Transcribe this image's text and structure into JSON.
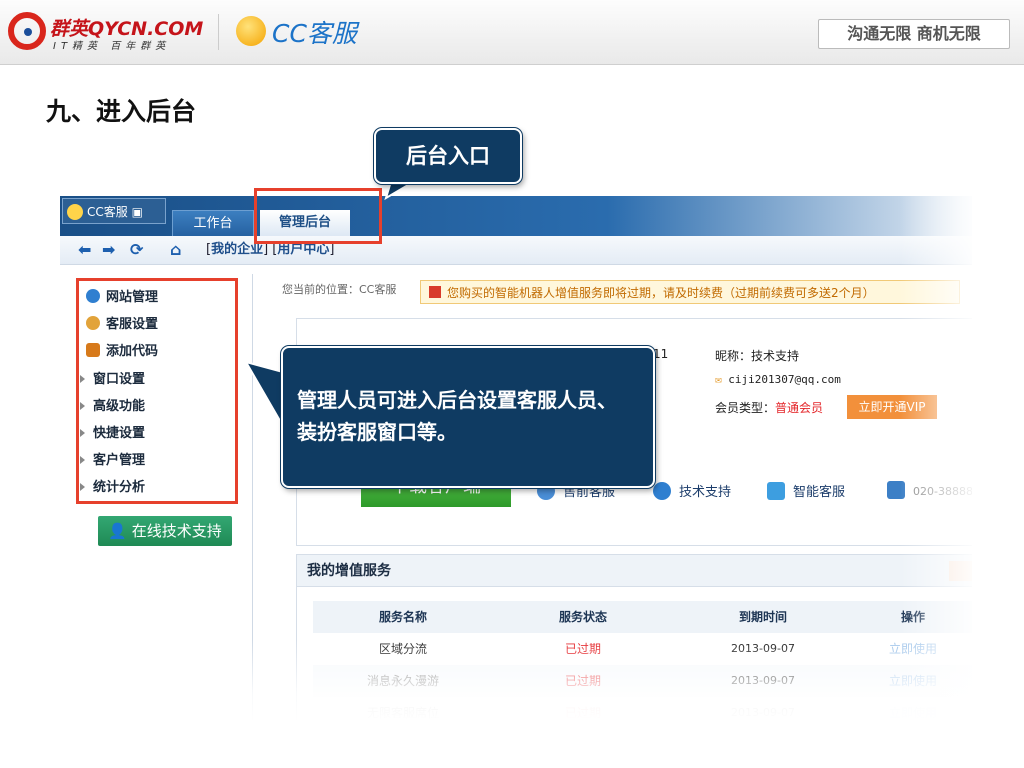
{
  "header": {
    "brand": "群英QYCN.COM",
    "brand_sub": "IT精英 百年群英",
    "product": "CC客服",
    "slogan": "沟通无限 商机无限"
  },
  "slide_title": "九、进入后台",
  "callouts": {
    "tab_callout": "后台入口",
    "sidebar_callout_line1": "管理人员可进入后台设置客服人员、",
    "sidebar_callout_line2": "装扮客服窗口等。"
  },
  "app": {
    "cc_button": "CC客服 ▣",
    "tabs": [
      "工作台",
      "管理后台"
    ],
    "nav_links": {
      "open": "[",
      "my_company": "我的企业",
      "mid": "] [",
      "user_center": "用户中心",
      "close": "]"
    },
    "sidebar": {
      "main_items": [
        "网站管理",
        "客服设置",
        "添加代码"
      ],
      "sub_items": [
        "窗口设置",
        "高级功能",
        "快捷设置",
        "客户管理",
        "统计分析"
      ],
      "support_button": "在线技术支持"
    },
    "breadcrumb": "您当前的位置：CC客服",
    "notice": "您购买的智能机器人增值服务即将过期，请及时续费（过期前续费可多送2个月）",
    "profile": {
      "id_fragment": "11",
      "nickname": "昵称：技术支持",
      "email": "ciji201307@qq.com",
      "member_type_label": "会员类型：",
      "member_type_value": "普通会员",
      "vip_button": "立即开通VIP",
      "download_button": "下载客户端",
      "services": [
        "售前客服",
        "技术支持",
        "智能客服"
      ],
      "phone": "020-38888"
    },
    "value_added": {
      "title": "我的增值服务",
      "columns": [
        "服务名称",
        "服务状态",
        "到期时间",
        "操作"
      ],
      "rows": [
        {
          "name": "区域分流",
          "status": "已过期",
          "expires": "2013-09-07",
          "action": "立即使用"
        },
        {
          "name": "消息永久漫游",
          "status": "已过期",
          "expires": "2013-09-07",
          "action": "立即使用"
        },
        {
          "name": "无限客服席位",
          "status": "已过期",
          "expires": "2013-09-07",
          "action": "立即使用"
        }
      ]
    }
  },
  "colors": {
    "highlight": "#e6402c",
    "callout_bg": "#0f3b62",
    "expired": "#e4262a",
    "accent_blue": "#1c73c8"
  }
}
